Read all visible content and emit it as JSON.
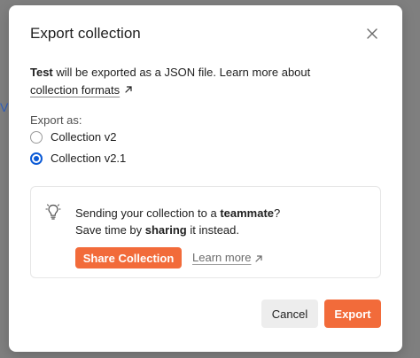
{
  "background": {
    "fragment_text": "V"
  },
  "dialog": {
    "title": "Export collection",
    "description": {
      "collection_name": "Test",
      "text": " will be exported as a JSON file. Learn more about",
      "link": "collection formats"
    },
    "export_as": {
      "label": "Export as:",
      "options": [
        {
          "label": "Collection v2",
          "selected": false
        },
        {
          "label": "Collection v2.1",
          "selected": true
        }
      ]
    },
    "tip": {
      "line1_prefix": "Sending your collection to a ",
      "line1_bold": "teammate",
      "line1_suffix": "?",
      "line2_prefix": "Save time by ",
      "line2_bold": "sharing",
      "line2_suffix": " it instead.",
      "share_button": "Share Collection",
      "learn_more": "Learn more"
    },
    "buttons": {
      "cancel": "Cancel",
      "export": "Export"
    }
  },
  "colors": {
    "accent": "#f26b3a",
    "radio_selected": "#0c5bd6",
    "overlay": "#7f7f7f"
  },
  "icons": {
    "close": "close-icon",
    "external_link": "external-link-icon",
    "lightbulb": "lightbulb-icon"
  }
}
